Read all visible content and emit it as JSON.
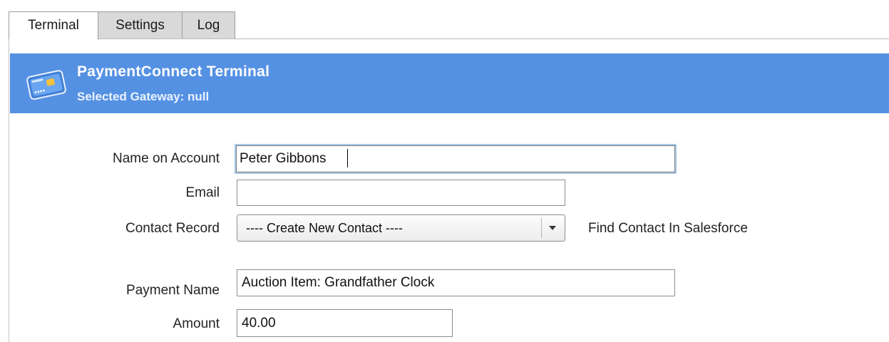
{
  "tabs": [
    {
      "label": "Terminal",
      "active": true
    },
    {
      "label": "Settings",
      "active": false
    },
    {
      "label": "Log",
      "active": false
    }
  ],
  "banner": {
    "title": "PaymentConnect Terminal",
    "subtitle": "Selected Gateway: null",
    "icon": "credit-card-icon",
    "background_color": "#5591e3"
  },
  "form": {
    "name_on_account": {
      "label": "Name on Account",
      "value": "Peter Gibbons"
    },
    "email": {
      "label": "Email",
      "value": ""
    },
    "contact_record": {
      "label": "Contact Record",
      "selected": "---- Create New Contact ----",
      "link": "Find Contact In Salesforce"
    },
    "payment_name": {
      "label": "Payment Name",
      "value": "Auction Item: Grandfather Clock"
    },
    "amount": {
      "label": "Amount",
      "value": "40.00"
    }
  }
}
